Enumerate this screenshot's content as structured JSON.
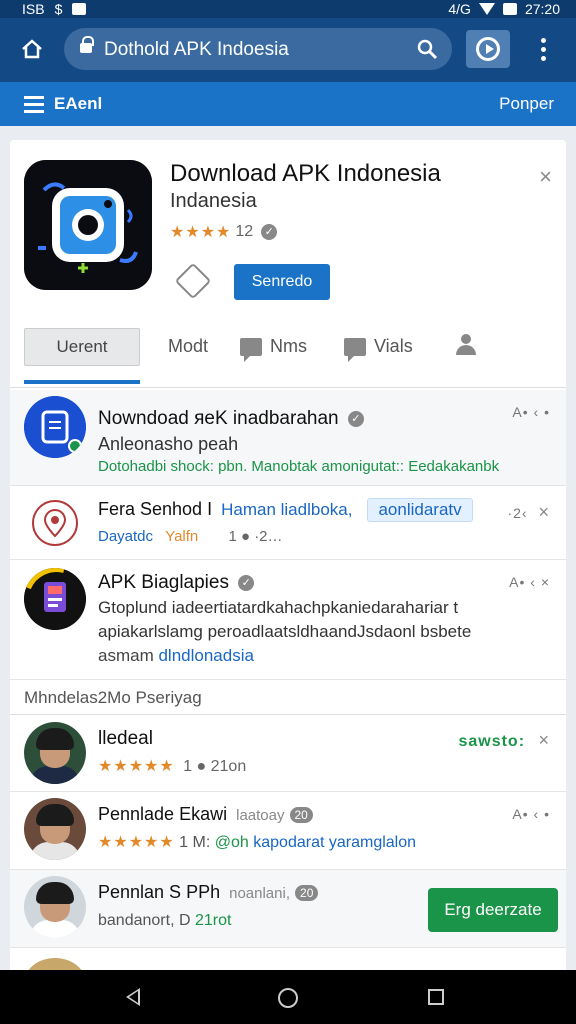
{
  "status_bar": {
    "left": [
      "ISB",
      "$"
    ],
    "right_time": "27:20",
    "right_extra": "4/G"
  },
  "browser": {
    "url": "Dothold APK Indoesia"
  },
  "site_header": {
    "brand": "EAenl",
    "right_link": "Ponper"
  },
  "app": {
    "title": "Download APK Indonesia",
    "subtitle": "Indanesia",
    "stars": "★★★★",
    "rating_count": "12",
    "install_label": "Senredo"
  },
  "tabs": [
    {
      "label": "Uerent"
    },
    {
      "label": "Modt"
    },
    {
      "label": "Nms"
    },
    {
      "label": "Vials"
    }
  ],
  "results": [
    {
      "title": "Nowndoad ᴙeK inadbarahan",
      "line2": "Anleonasho peah",
      "line3": "Dotohadbi shock: pbn. Manobtak amonigutat:: Eedakakanbk",
      "meta": "A• ‹ •"
    },
    {
      "title": "Fera Senhod I",
      "title_blue": "Haman liadlboka,",
      "chip": "aonlidaratv",
      "line2_blue": "Dayatdc",
      "line2_orange": "Yalfn",
      "line2_rest": "1 ● ·2…",
      "meta": "·2‹"
    },
    {
      "title": "APK Biaglapies",
      "line2": "Gtoplund iadeertiatardkahachpkaniedarahariar t",
      "line3": "apiakarlslamg  peroadlaatsldhaandJsdaonl bsbete",
      "line4": "asmam",
      "line4_blue": "dlndlonadsia",
      "meta": "A• ‹ ×"
    }
  ],
  "section_label": "Mhndelas2Mo Pseriyag",
  "people": [
    {
      "name": "lledeal",
      "stars": "★★★★★",
      "detail": "1 ● 21on",
      "right_label": "sawsto:"
    },
    {
      "name": "Pennlade Ekawi",
      "handle": "laatoay",
      "badge": "20",
      "stars": "★★★★★",
      "detail_num": "1 M:",
      "detail_green": "@oh",
      "detail_blue": "kapodarat yaramglalon",
      "meta": "A• ‹ •"
    },
    {
      "name": "Pennlan S PPh",
      "handle": "noanlani,",
      "badge": "20",
      "detail": "bandanort, D",
      "detail_green": "21rot",
      "cta_label": "Erg deerzate"
    }
  ],
  "colors": {
    "primary": "#1a73c7",
    "header": "#134a86",
    "green": "#1a9448",
    "star": "#e08a2c"
  }
}
